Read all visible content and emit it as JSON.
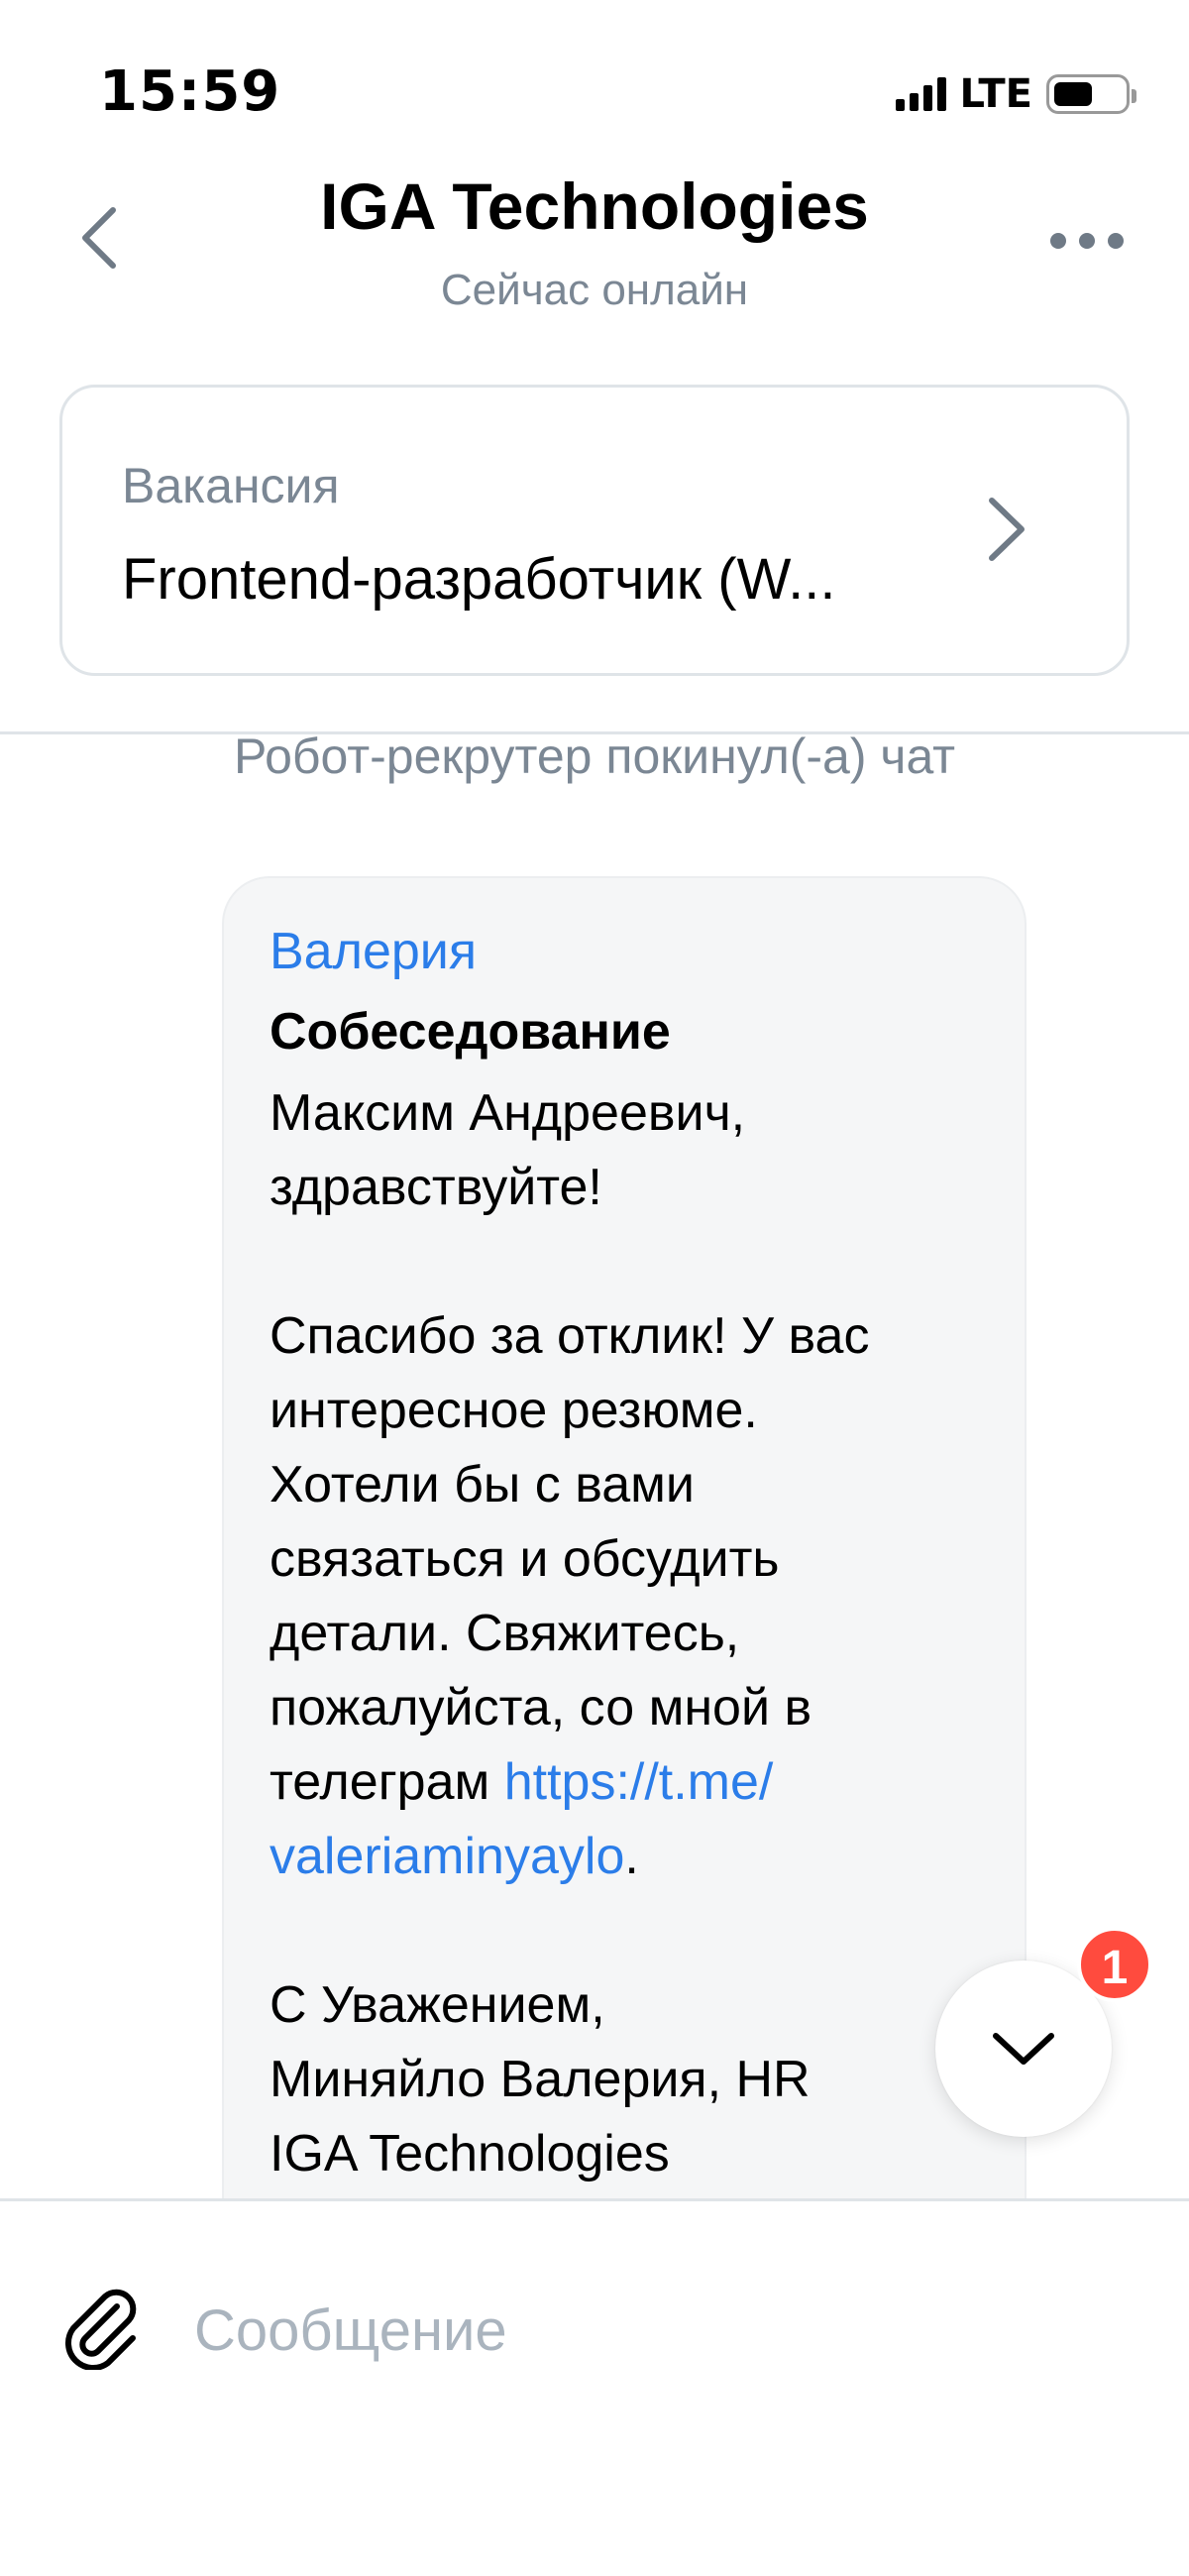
{
  "status_bar": {
    "time": "15:59",
    "network": "LTE"
  },
  "header": {
    "title": "IGA Technologies",
    "subtitle": "Сейчас онлайн",
    "back_icon": "chevron-left-icon",
    "more_icon": "more-horizontal-icon"
  },
  "vacancy": {
    "label": "Вакансия",
    "title": "Frontend-разработчик (W..."
  },
  "system_message": "Робот-рекрутер покинул(-а) чат",
  "message": {
    "sender": "Валерия",
    "subject": "Собеседование",
    "greeting_line1": "Максим Андреевич,",
    "greeting_line2": "здравствуйте!",
    "body_line1": "Спасибо за отклик! У вас",
    "body_line2": "интересное резюме.",
    "body_line3": "Хотели бы с вами",
    "body_line4": "связаться и обсудить",
    "body_line5": "детали. Свяжитесь,",
    "body_line6": "пожалуйста, со мной в",
    "body_line7_prefix": "телеграм ",
    "link_part1": "https://t.me/",
    "link_part2": "valeriaminyaylo",
    "link_suffix": ".",
    "sign_line1": "С Уважением,",
    "sign_line2": "Миняйло Валерия, HR",
    "sign_line3": "IGA Technologies"
  },
  "scroll_button": {
    "unread_count": "1"
  },
  "composer": {
    "placeholder": "Сообщение"
  },
  "colors": {
    "accent": "#2b7de9",
    "muted_text": "#7b8794",
    "badge": "#ff4b3e",
    "bubble_bg": "#f5f6f7"
  }
}
